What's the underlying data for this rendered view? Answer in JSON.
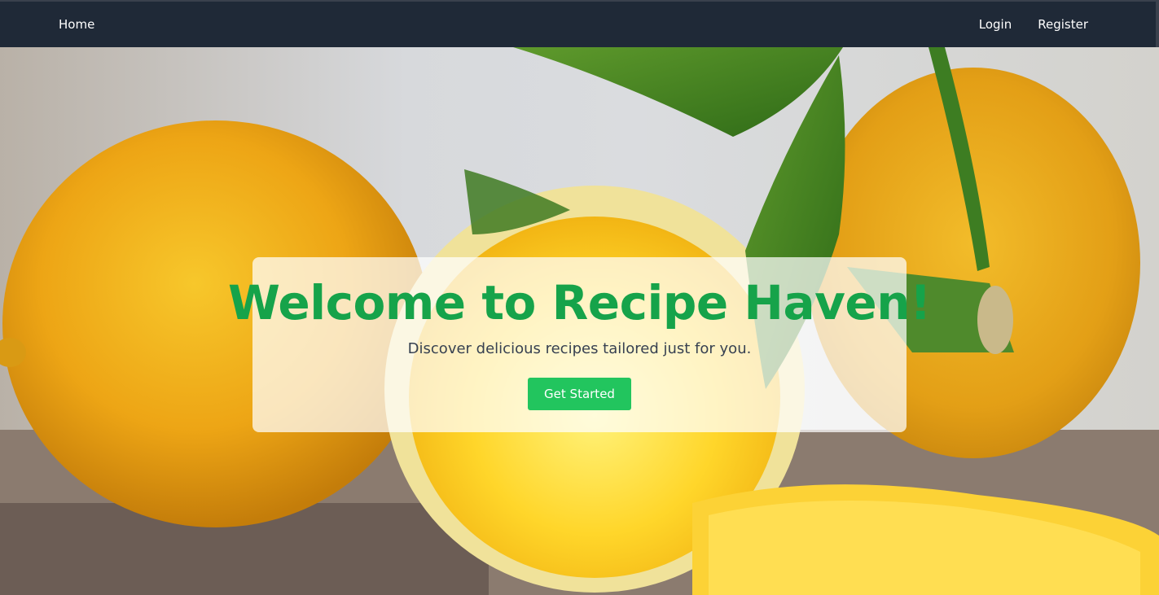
{
  "nav": {
    "home_label": "Home",
    "login_label": "Login",
    "register_label": "Register"
  },
  "hero": {
    "background_image": "lemons-with-leaves-photo",
    "title": "Welcome to Recipe Haven!",
    "subtitle": "Discover delicious recipes tailored just for you.",
    "cta_label": "Get Started"
  },
  "colors": {
    "navbar_bg": "#1f2937",
    "title_green": "#16a34a",
    "button_green": "#22c55e",
    "subtitle_gray": "#374151"
  }
}
